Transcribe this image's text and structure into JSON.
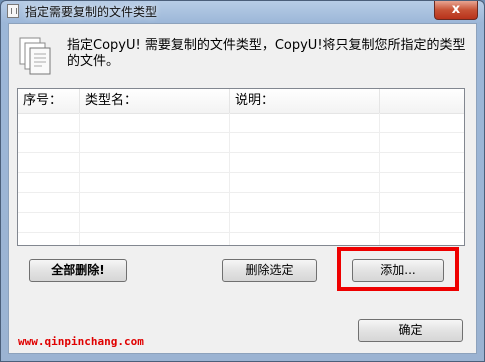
{
  "window": {
    "title": "指定需要复制的文件类型",
    "close_label": "x"
  },
  "info": {
    "text": "指定CopyU! 需要复制的文件类型，CopyU!将只复制您所指定的类型的文件。"
  },
  "list": {
    "columns": [
      "序号：",
      "类型名：",
      "说明："
    ],
    "rows": []
  },
  "buttons": {
    "delete_all": "全部删除!",
    "delete_selected": "删除选定",
    "add": "添加...",
    "ok": "确定"
  },
  "watermark": {
    "text": "www.qinpinchang.com"
  }
}
